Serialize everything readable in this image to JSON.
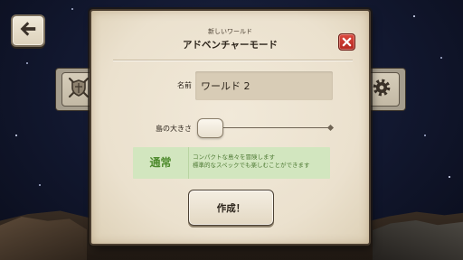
{
  "screen": {
    "back_button": {
      "icon": "arrow-left-icon"
    },
    "background_toolbar": {
      "left_icon": "crossed-swords-shield-icon",
      "right_icon": "gear-icon"
    }
  },
  "dialog": {
    "subtitle": "新しいワールド",
    "title": "アドベンチャーモード",
    "close_icon": "close-icon",
    "name_field": {
      "label": "名前",
      "value": "ワールド 2"
    },
    "island_size": {
      "label": "島の大きさ",
      "level": 0
    },
    "mode_info": {
      "mode": "通常",
      "description_lines": [
        "コンパクトな島々を冒険します",
        "標準的なスペックでも楽しむことができます"
      ]
    },
    "create_button": {
      "label": "作成！"
    }
  },
  "colors": {
    "parchment": "#ede4d3",
    "close_red": "#c9342c",
    "mode_green": "#4d8a2c",
    "mode_background": "#d2e6bf",
    "night_sky": "#121830"
  }
}
